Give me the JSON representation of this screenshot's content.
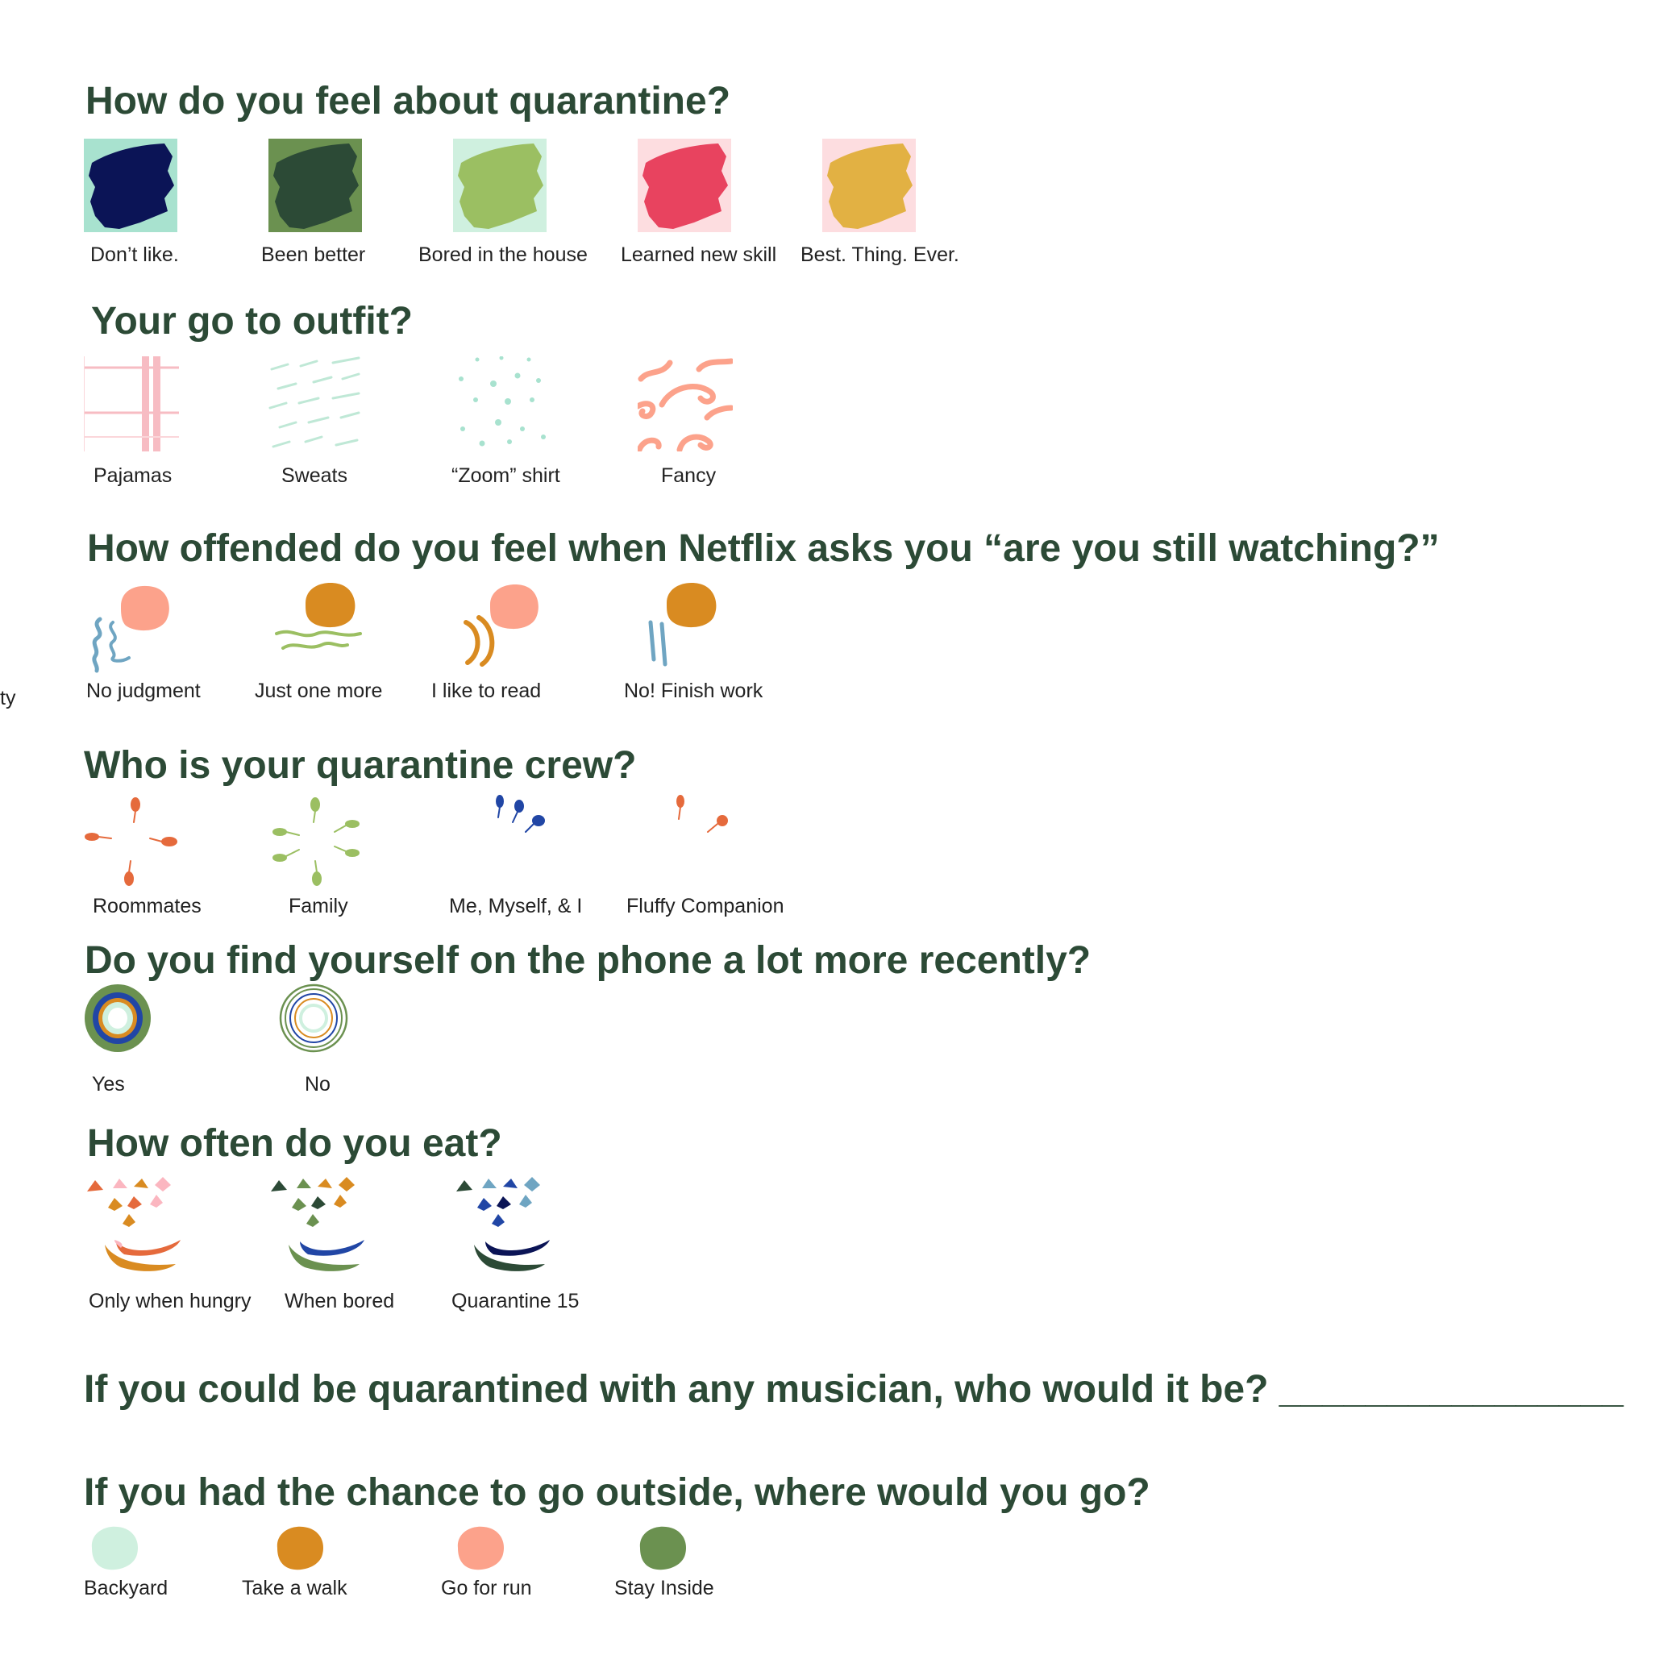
{
  "colors": {
    "heading": "#2c4a36",
    "navy": "#0b1456",
    "dark_green": "#2c4a36",
    "olive": "#6b9150",
    "lime": "#9bbf62",
    "pink_red": "#e8435f",
    "mustard": "#e2b143",
    "mint": "#a8e2cf",
    "pale_mint": "#cff0df",
    "pale_pink": "#fddde0",
    "salmon": "#fca28b",
    "orange": "#d98b21",
    "steel_blue": "#6fa5c2",
    "coral": "#e56a3c",
    "royal_blue": "#2146a5"
  },
  "stray_text": "ty",
  "q1": {
    "title": "How do you feel about quarantine?",
    "options": [
      {
        "label": "Don’t like.",
        "icon": "navy-brush-stroke-icon"
      },
      {
        "label": "Been better",
        "icon": "dark-green-brush-stroke-icon"
      },
      {
        "label": "Bored in the house",
        "icon": "lime-brush-stroke-icon"
      },
      {
        "label": "Learned new skill",
        "icon": "red-brush-stroke-icon"
      },
      {
        "label": "Best. Thing. Ever.",
        "icon": "mustard-brush-stroke-icon"
      }
    ]
  },
  "q2": {
    "title": "Your go to outfit?",
    "options": [
      {
        "label": "Pajamas",
        "icon": "plaid-pattern-icon"
      },
      {
        "label": "Sweats",
        "icon": "dash-pattern-icon"
      },
      {
        "label": "“Zoom” shirt",
        "icon": "dot-pattern-icon"
      },
      {
        "label": "Fancy",
        "icon": "swirl-pattern-icon"
      }
    ]
  },
  "q3": {
    "title": "How offended do you feel when Netflix asks you “are you still watching?”",
    "options": [
      {
        "label": "No judgment",
        "icon": "salmon-blob-wavy-lines-icon"
      },
      {
        "label": "Just one more",
        "icon": "orange-blob-wavy-lines-icon"
      },
      {
        "label": "I like to read",
        "icon": "salmon-blob-arcs-icon"
      },
      {
        "label": "No! Finish work",
        "icon": "orange-blob-straight-lines-icon"
      }
    ]
  },
  "q4": {
    "title": "Who is your quarantine crew?",
    "options": [
      {
        "label": "Roommates",
        "icon": "four-petal-sparkle-icon"
      },
      {
        "label": "Family",
        "icon": "six-petal-sparkle-icon"
      },
      {
        "label": "Me, Myself, & I",
        "icon": "three-petal-icon"
      },
      {
        "label": "Fluffy Companion",
        "icon": "two-petal-icon"
      }
    ]
  },
  "q5": {
    "title": "Do you find yourself on the phone a lot more recently?",
    "options": [
      {
        "label": "Yes",
        "icon": "thick-rings-icon"
      },
      {
        "label": "No",
        "icon": "thin-rings-icon"
      }
    ]
  },
  "q6": {
    "title": "How often do you eat?",
    "options": [
      {
        "label": "Only when hungry",
        "icon": "warm-smiley-face-icon"
      },
      {
        "label": "When bored",
        "icon": "green-smiley-face-icon"
      },
      {
        "label": "Quarantine 15",
        "icon": "blue-smiley-face-icon"
      }
    ]
  },
  "q7": {
    "title": "If you could be quarantined with any musician, who would it be? ________________"
  },
  "q8": {
    "title": "If you had the chance to go outside, where would you go?",
    "options": [
      {
        "label": "Backyard",
        "icon": "mint-blob-icon"
      },
      {
        "label": "Take a walk",
        "icon": "orange-blob-icon"
      },
      {
        "label": "Go for run",
        "icon": "salmon-blob-icon"
      },
      {
        "label": "Stay Inside",
        "icon": "olive-blob-icon"
      }
    ]
  }
}
